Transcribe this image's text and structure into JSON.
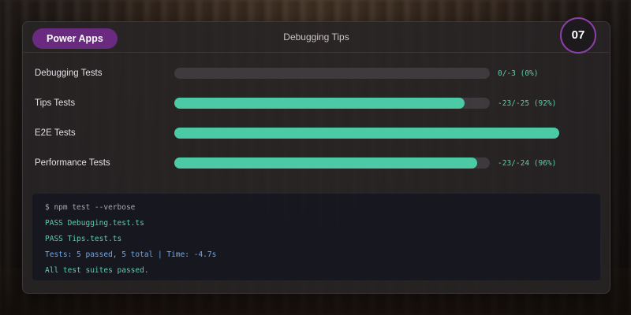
{
  "header": {
    "brand": "Power Apps",
    "title": "Debugging Tips",
    "step": "07"
  },
  "tests": [
    {
      "label": "Debugging Tests",
      "progress": 0.0,
      "stat": "0/-3 (0%)"
    },
    {
      "label": "Tips Tests",
      "progress": 0.92,
      "stat": "-23/-25 (92%)"
    },
    {
      "label": "E2E Tests",
      "progress": 1.0,
      "stat": ""
    },
    {
      "label": "Performance Tests",
      "progress": 0.96,
      "stat": "-23/-24 (96%)"
    }
  ],
  "terminal": {
    "lines": [
      {
        "text": "$ npm test --verbose",
        "color": "#a8a8b0"
      },
      {
        "text": "PASS Debugging.test.ts",
        "color": "#58cfad"
      },
      {
        "text": "PASS Tips.test.ts",
        "color": "#58cfad"
      },
      {
        "text": "Tests: 5 passed, 5 total | Time: -4.7s",
        "color": "#6aa8f0"
      },
      {
        "text": "All test suites passed.",
        "color": "#58cfad"
      }
    ]
  },
  "colors": {
    "accent": "#6a2a80",
    "badge_ring": "#8e3fa6",
    "bar_fill": "#4ccaa6",
    "bar_track": "#464246",
    "terminal_bg": "#161820"
  }
}
